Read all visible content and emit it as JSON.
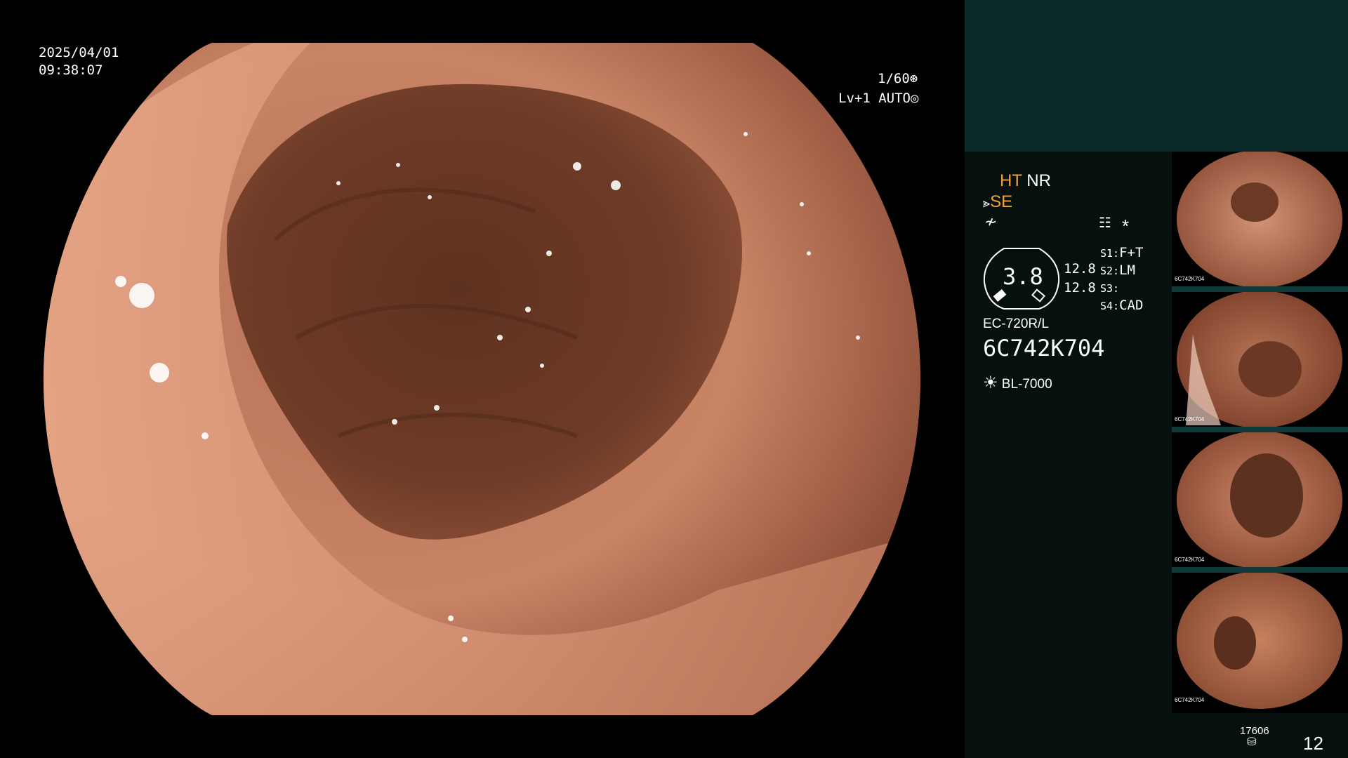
{
  "overlay": {
    "date": "2025/04/01",
    "time": "09:38:07",
    "shutter": "1/60",
    "level": "Lv+1",
    "iris": "AUTO"
  },
  "status": {
    "ht": "HT",
    "nr": "NR",
    "se": "SE",
    "sensor_value": "3.8",
    "dia_top": "12.8",
    "dia_bottom": "12.8",
    "switches": [
      {
        "key": "S1:",
        "value": "F+T"
      },
      {
        "key": "S2:",
        "value": "LM"
      },
      {
        "key": "S3:",
        "value": ""
      },
      {
        "key": "S4:",
        "value": "CAD"
      }
    ],
    "scope_model": "EC-720R/L",
    "serial": "6C742K704",
    "light_source": "BL-7000",
    "asterisk": "*"
  },
  "footer": {
    "storage_count": "17606",
    "image_count": "12"
  },
  "thumbnails": [
    {
      "caption": "6C742K704"
    },
    {
      "caption": "6C742K704"
    },
    {
      "caption": "6C742K704"
    },
    {
      "caption": "6C742K704"
    }
  ],
  "colors": {
    "accent_orange": "#f2a03a",
    "panel_top": "#0b2a2a",
    "panel_bottom": "#05100f"
  },
  "icons": {
    "shutter": "aperture-icon",
    "iris": "iris-icon",
    "light": "sun-icon",
    "storage": "disk-icon"
  }
}
